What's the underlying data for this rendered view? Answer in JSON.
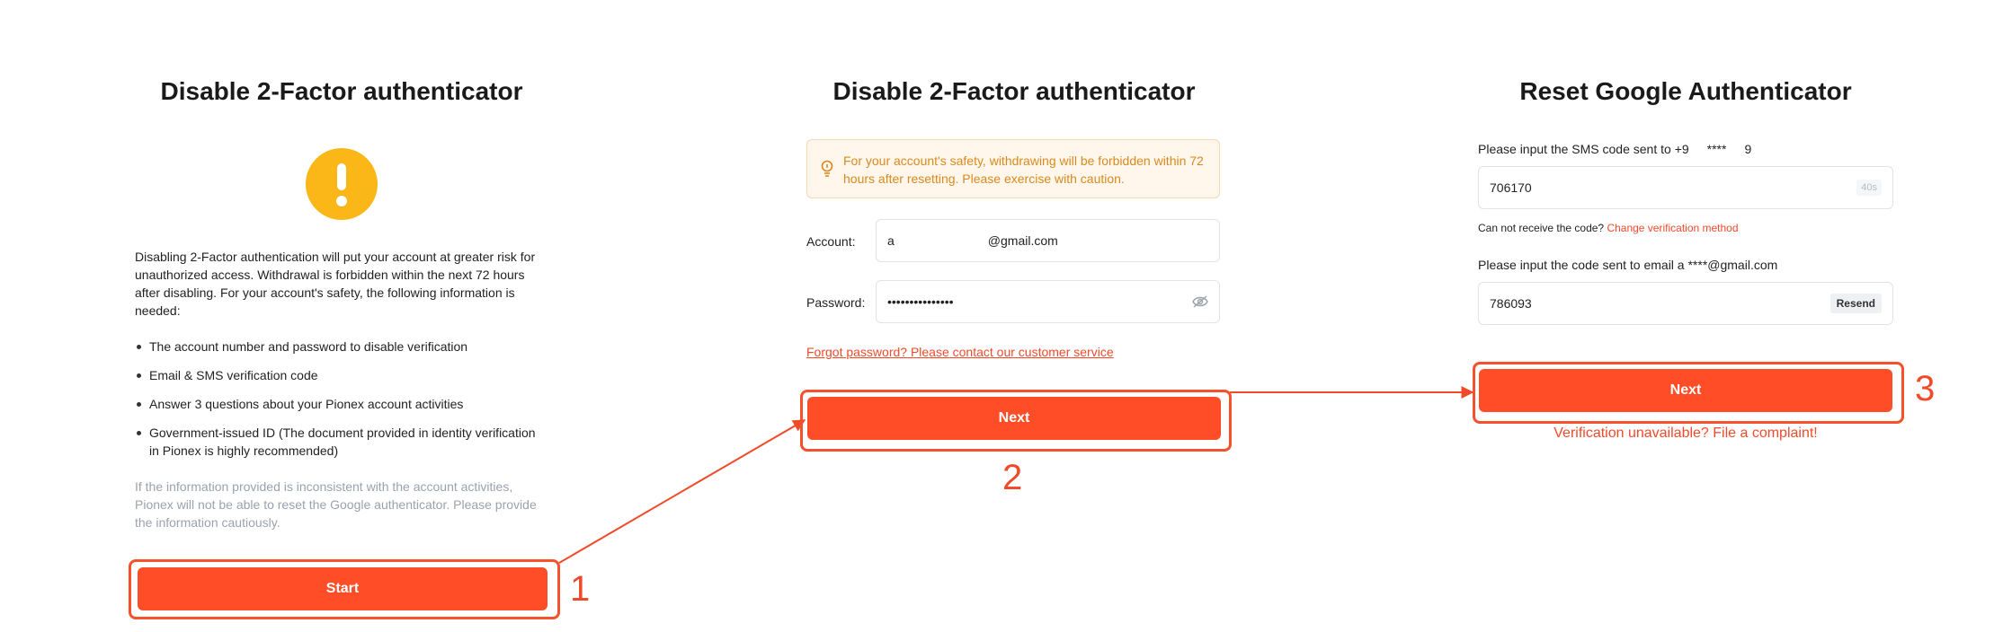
{
  "step1": {
    "title": "Disable 2-Factor authenticator",
    "intro": "Disabling 2-Factor authentication will put your account at greater risk for unauthorized access. Withdrawal is forbidden within the next 72 hours after disabling. For your account's safety, the following information is needed:",
    "requirements": [
      "The account number and password to disable verification",
      "Email & SMS verification code",
      "Answer 3 questions about your Pionex account activities",
      "Government-issued ID (The document provided in identity verification in Pionex is highly recommended)"
    ],
    "note": "If the information provided is inconsistent with the account activities, Pionex will not be able to reset the Google authenticator. Please provide the information cautiously.",
    "start_label": "Start",
    "step_number": "1"
  },
  "step2": {
    "title": "Disable 2-Factor authenticator",
    "notice": "For your account's safety, withdrawing will be forbidden within 72 hours after resetting. Please exercise with caution.",
    "account_label": "Account",
    "account_prefix": "a",
    "account_suffix": "@gmail.com",
    "password_label": "Password",
    "password_value": "•••••••••••••••",
    "forgot_link": "Forgot password? Please contact our customer service",
    "next_label": "Next",
    "step_number": "2"
  },
  "step3": {
    "title": "Reset Google Authenticator",
    "sms_prompt_prefix": "Please input the SMS code sent to +9",
    "sms_prompt_mask": "****",
    "sms_prompt_suffix": "9",
    "sms_code": "706170",
    "sms_timer": "40s",
    "cannot_receive": "Can not receive the code?",
    "change_method": "Change verification method",
    "email_prompt": "Please input the code sent to email a ****@gmail.com",
    "email_code": "786093",
    "resend_label": "Resend",
    "next_label": "Next",
    "complaint": "Verification unavailable? File a complaint!",
    "step_number": "3"
  },
  "colors": {
    "accent": "#ff4d28",
    "highlight": "#f4512c",
    "warning": "#fbb617",
    "notice_text": "#d98a1e"
  }
}
